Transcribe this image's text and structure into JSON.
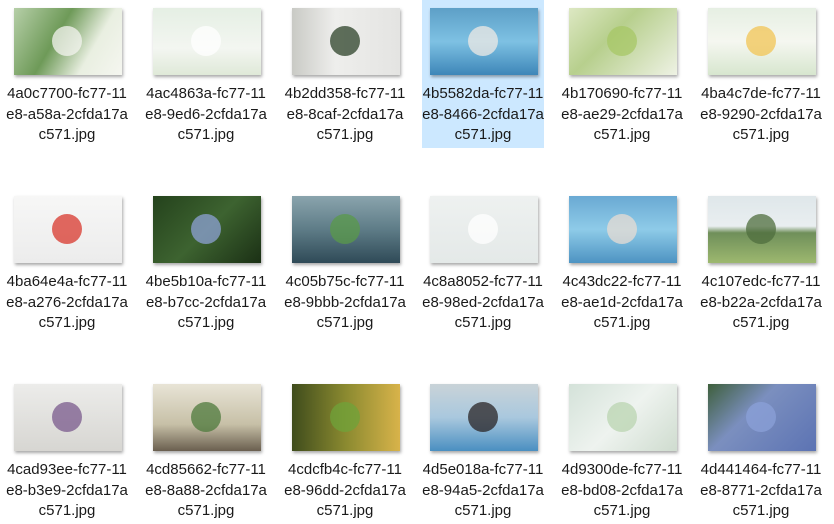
{
  "files": [
    {
      "name": "4a0c7700-fc77-11e8-a58a-2cfda17ac571.jpg",
      "bg": "linear-gradient(120deg,#b6cfa8,#6e9a58 40%,#e9efe1 70%,#f5f6f0)",
      "accent": "#f4f4f0"
    },
    {
      "name": "4ac4863a-fc77-11e8-9ed6-2cfda17ac571.jpg",
      "bg": "linear-gradient(180deg,#e5efe4,#f3f6f1 60%,#dfe9d8)",
      "accent": "#ffffff"
    },
    {
      "name": "4b2dd358-fc77-11e8-8caf-2cfda17ac571.jpg",
      "bg": "linear-gradient(90deg,#c9cac5,#eeeeec 40%,#e4e4e2)",
      "accent": "#2c4228"
    },
    {
      "name": "4b5582da-fc77-11e8-8466-2cfda17ac571.jpg",
      "bg": "linear-gradient(180deg,#5d9fc7,#7ec1e3 50%,#3d86b8)",
      "accent": "#efe9e4"
    },
    {
      "name": "4b170690-fc77-11e8-ae29-2cfda17ac571.jpg",
      "bg": "linear-gradient(135deg,#dde8c3,#b7cf8d 40%,#eef2e4)",
      "accent": "#a7c766"
    },
    {
      "name": "4ba4c7de-fc77-11e8-9290-2cfda17ac571.jpg",
      "bg": "linear-gradient(180deg,#e6efe3,#f5f7f0 50%,#d7e6cf)",
      "accent": "#f1c454"
    },
    {
      "name": "4ba64e4a-fc77-11e8-a276-2cfda17ac571.jpg",
      "bg": "linear-gradient(180deg,#f7f7f6,#ececec)",
      "accent": "#d8372c"
    },
    {
      "name": "4be5b10a-fc77-11e8-b7cc-2cfda17ac571.jpg",
      "bg": "linear-gradient(135deg,#24421c,#3d6330 50%,#1b3015)",
      "accent": "#8ea2d6"
    },
    {
      "name": "4c05b75c-fc77-11e8-9bbb-2cfda17ac571.jpg",
      "bg": "linear-gradient(180deg,#8aa4ad,#5e7c87 50%,#2f4a57)",
      "accent": "#5a9a4a"
    },
    {
      "name": "4c8a8052-fc77-11e8-98ed-2cfda17ac571.jpg",
      "bg": "linear-gradient(180deg,#eef1f0,#e4e9e8)",
      "accent": "#ffffff"
    },
    {
      "name": "4c43dc22-fc77-11e8-ae1d-2cfda17ac571.jpg",
      "bg": "linear-gradient(180deg,#6aa9d3,#8ecbe8 50%,#4d93c2)",
      "accent": "#e8dcd3"
    },
    {
      "name": "4c107edc-fc77-11e8-b22a-2cfda17ac571.jpg",
      "bg": "linear-gradient(180deg,#dfe7ea 0%,#e9eef0 45%,#6f8f5a 55%,#9db86f 100%)",
      "accent": "#4f6d3e"
    },
    {
      "name": "4cad93ee-fc77-11e8-b3e9-2cfda17ac571.jpg",
      "bg": "linear-gradient(180deg,#ececea,#d7d6d2)",
      "accent": "#7a5a8c"
    },
    {
      "name": "4cd85662-fc77-11e8-8a88-2cfda17ac571.jpg",
      "bg": "linear-gradient(180deg,#e8e4d6,#c7c0a7 60%,#6a5f4f)",
      "accent": "#4d7a3c"
    },
    {
      "name": "4cdcfb4c-fc77-11e8-96dd-2cfda17ac571.jpg",
      "bg": "linear-gradient(90deg,#3f4c1c,#8b8a30 50%,#d8b34a)",
      "accent": "#6fa33a"
    },
    {
      "name": "4d5e018a-fc77-11e8-94a5-2cfda17ac571.jpg",
      "bg": "linear-gradient(180deg,#c9d3d8,#a9c8de 50%,#4a8fc1)",
      "accent": "#2a2426"
    },
    {
      "name": "4d9300de-fc77-11e8-bd08-2cfda17ac571.jpg",
      "bg": "linear-gradient(135deg,#d4e2d9,#eef3ef 50%,#cfdccf)",
      "accent": "#b9d4b0"
    },
    {
      "name": "4d441464-fc77-11e8-8771-2cfda17ac571.jpg",
      "bg": "linear-gradient(135deg,#3e5f3c,#7b8fbf 40%,#5c73b3)",
      "accent": "#8ba0d8"
    }
  ],
  "selected_index": 3,
  "colors": {
    "selection": "#cce8ff",
    "text": "#1a1a1a",
    "background": "#ffffff"
  }
}
